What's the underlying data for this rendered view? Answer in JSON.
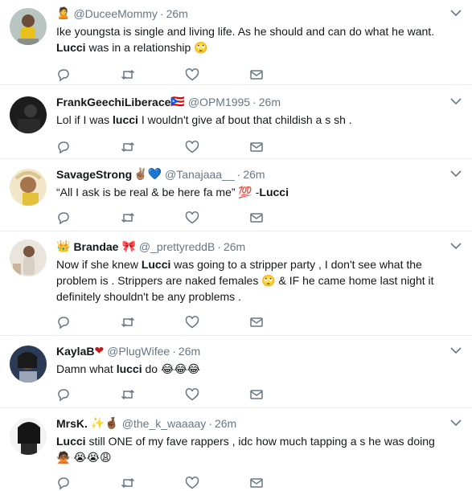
{
  "tweets": [
    {
      "name": "",
      "name_emoji": "🙎",
      "handle": "@DuceeMommy",
      "time": "26m",
      "segments": [
        {
          "t": "Ike youngsta is single and living life. As he should and can do what he want. "
        },
        {
          "b": "Lucci"
        },
        {
          "t": " was in a relationship 🙄"
        }
      ]
    },
    {
      "name": "FrankGeechiLiberace",
      "name_emoji": "🇵🇷",
      "handle": "@OPM1995",
      "time": "26m",
      "segments": [
        {
          "t": "Lol if I was "
        },
        {
          "b": "lucci"
        },
        {
          "t": " I wouldn't give af bout that childish a  s sh  ."
        }
      ]
    },
    {
      "name": "SavageStrong",
      "name_emoji": "✌🏽💙",
      "handle": "@Tanajaaa__",
      "time": "26m",
      "segments": [
        {
          "t": "“All I ask is be real & be here fa me” 💯 -"
        },
        {
          "b": "Lucci"
        }
      ]
    },
    {
      "name": "Brandae",
      "name_prefix": "👑",
      "name_emoji": "🎀",
      "handle": "@_prettyreddB",
      "time": "26m",
      "segments": [
        {
          "t": "Now if she knew "
        },
        {
          "b": "Lucci"
        },
        {
          "t": " was going to a stripper party , I don't see what the problem is . Strippers are naked females 🙄 & IF he came home last night it definitely shouldn't be any problems ."
        }
      ]
    },
    {
      "name": "KaylaB",
      "name_emoji": "❤",
      "handle": "@PlugWifee",
      "time": "26m",
      "segments": [
        {
          "t": "Damn what "
        },
        {
          "b": "lucci"
        },
        {
          "t": " do 😂😂😂"
        }
      ]
    },
    {
      "name": "MrsK.",
      "name_emoji": "✨🤞🏾",
      "handle": "@the_k_waaaay",
      "time": "26m",
      "segments": [
        {
          "b": "Lucci"
        },
        {
          "t": " still ONE of my fave rappers , idc how much tapping a  s he was doing 🙅🏾 😭😭😩"
        }
      ]
    }
  ],
  "colors": {
    "icon_gray": "#657786",
    "divider": "#e6ecf0",
    "text": "#14171a"
  },
  "icons": [
    "reply-icon",
    "retweet-icon",
    "like-icon",
    "message-icon",
    "chevron-down-icon"
  ]
}
